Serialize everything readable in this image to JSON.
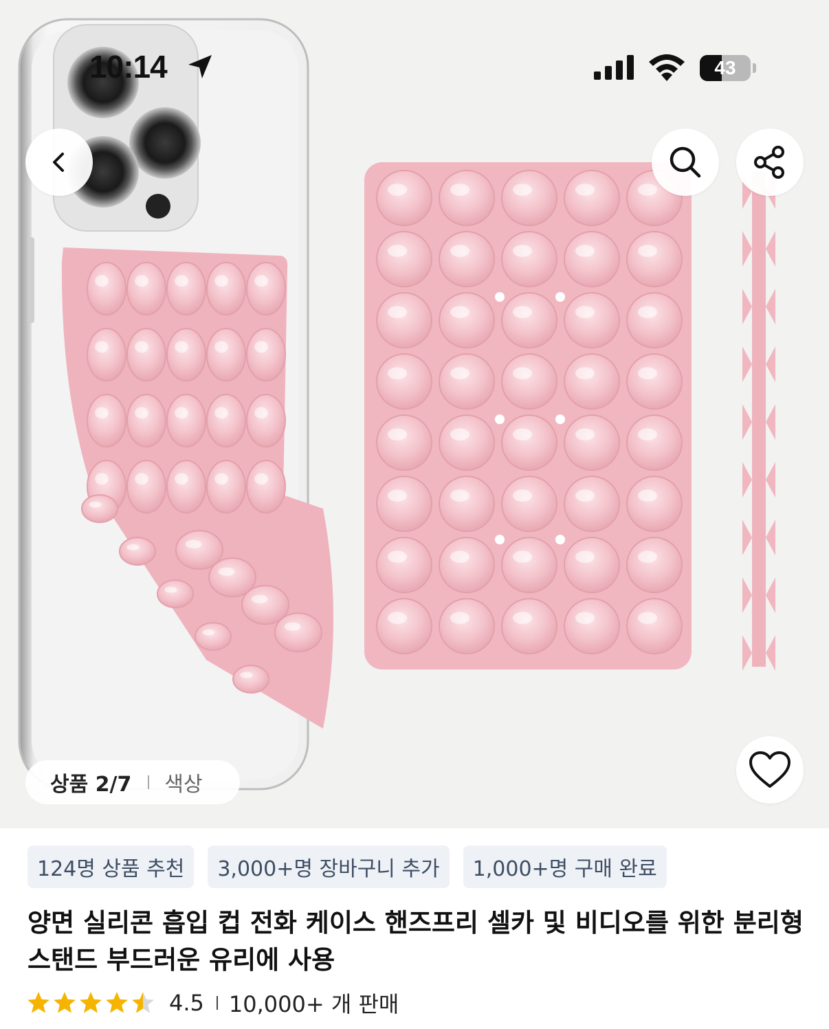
{
  "status_bar": {
    "time": "10:14",
    "battery": "43",
    "battery_level": 0.43
  },
  "header": {
    "back_icon": "chevron-left-icon",
    "search_icon": "search-icon",
    "share_icon": "share-icon"
  },
  "gallery": {
    "counter_label": "상품 2/7",
    "color_tab": "색상",
    "favorite_icon": "heart-icon"
  },
  "chips": [
    "124명 상품 추천",
    "3,000+명 장바구니 추가",
    "1,000+명 구매 완료"
  ],
  "product": {
    "title": "양면 실리콘 흡입 컵 전화 케이스 핸즈프리 셀카 및 비디오를 위한 분리형 스탠드 부드러운 유리에 사용",
    "rating": "4.5",
    "rating_stars": 4.5,
    "sold": "10,000+ 개 판매"
  },
  "colors": {
    "star": "#f5b400",
    "chip_bg": "#eef2f7",
    "chip_text": "#3e4d63",
    "product_pink": "#f0b7c0"
  }
}
